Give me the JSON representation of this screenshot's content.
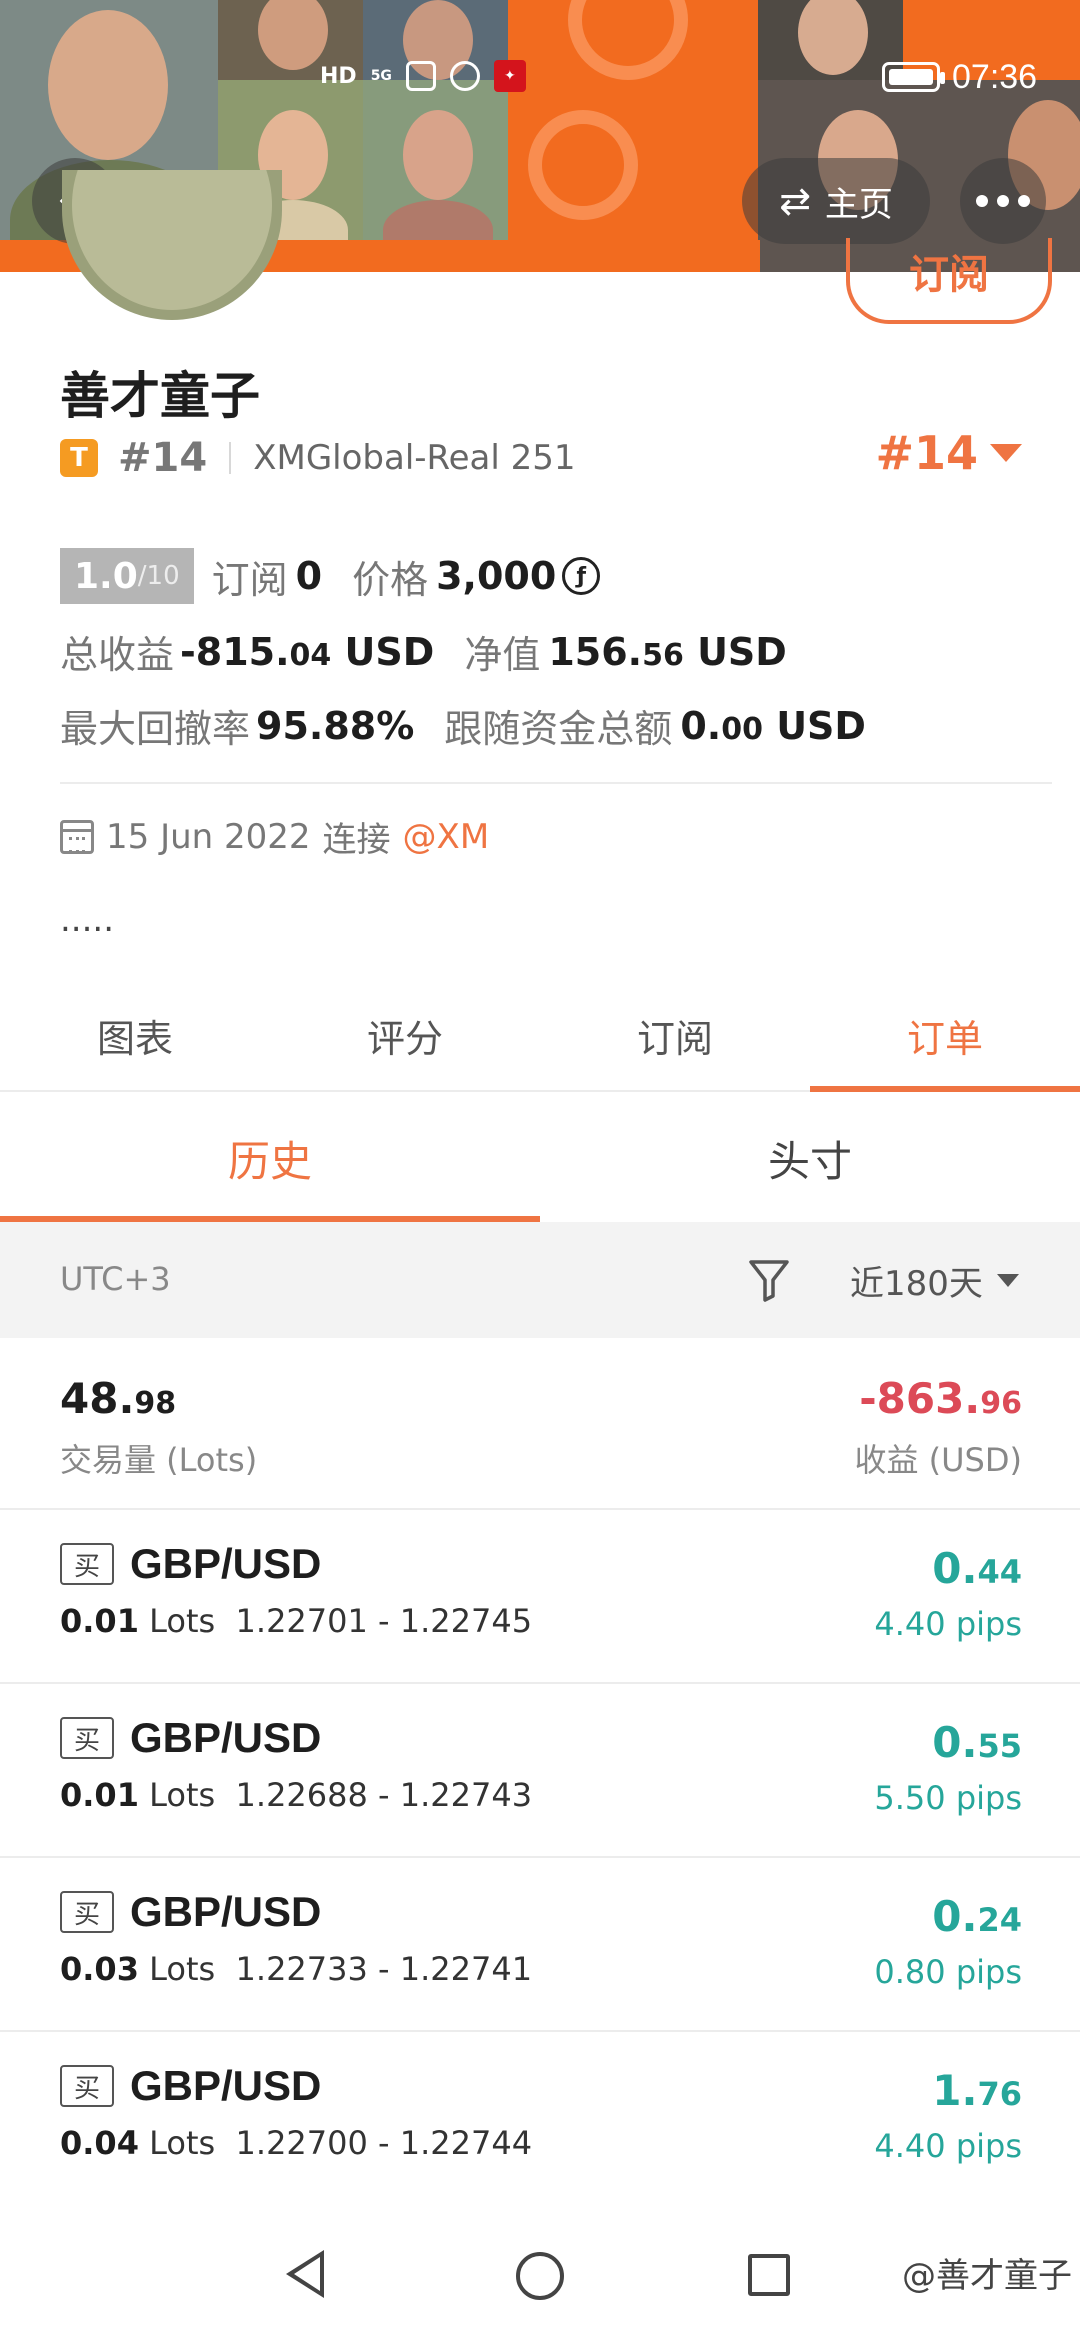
{
  "status_bar": {
    "network": "HD",
    "signal": "5G",
    "time": "07:36"
  },
  "header": {
    "home_label": "主页",
    "subscribe_label": "订阅"
  },
  "profile": {
    "name": "善才童子",
    "tier_badge": "T",
    "rank": "#14",
    "server": "XMGlobal-Real 251",
    "rank_right": "#14",
    "rating": "1.0",
    "rating_max": "/10",
    "subscriptions_label": "订阅",
    "subscriptions_value": "0",
    "price_label": "价格",
    "price_value": "3,000",
    "price_currency_icon": "ƒ",
    "total_profit_label": "总收益",
    "total_profit_main": "-815.",
    "total_profit_decimals": "04",
    "total_profit_unit": "USD",
    "equity_label": "净值",
    "equity_main": "156.",
    "equity_decimals": "56",
    "equity_unit": "USD",
    "max_drawdown_label": "最大回撤率",
    "max_drawdown_value": "95.88%",
    "follower_funds_label": "跟随资金总额",
    "follower_funds_main": "0.",
    "follower_funds_decimals": "00",
    "follower_funds_unit": "USD",
    "join_date": "15 Jun 2022",
    "join_text": "连接",
    "broker": "@XM",
    "description": "....."
  },
  "tabs": [
    "图表",
    "评分",
    "订阅",
    "订单"
  ],
  "active_tab": 3,
  "subtabs": [
    "历史",
    "头寸"
  ],
  "active_subtab": 0,
  "filter": {
    "timezone": "UTC+3",
    "period": "近180天"
  },
  "summary": {
    "volume_main": "48.",
    "volume_decimals": "98",
    "volume_label": "交易量 (Lots)",
    "profit_main": "-863.",
    "profit_decimals": "96",
    "profit_label": "收益 (USD)"
  },
  "orders": [
    {
      "side": "买",
      "symbol": "GBP/USD",
      "lots": "0.01",
      "lots_unit": "Lots",
      "prices": "1.22701 - 1.22745",
      "profit_main": "0.",
      "profit_decimals": "44",
      "pips": "4.40 pips"
    },
    {
      "side": "买",
      "symbol": "GBP/USD",
      "lots": "0.01",
      "lots_unit": "Lots",
      "prices": "1.22688 - 1.22743",
      "profit_main": "0.",
      "profit_decimals": "55",
      "pips": "5.50 pips"
    },
    {
      "side": "买",
      "symbol": "GBP/USD",
      "lots": "0.03",
      "lots_unit": "Lots",
      "prices": "1.22733 - 1.22741",
      "profit_main": "0.",
      "profit_decimals": "24",
      "pips": "0.80 pips"
    },
    {
      "side": "买",
      "symbol": "GBP/USD",
      "lots": "0.04",
      "lots_unit": "Lots",
      "prices": "1.22700 - 1.22744",
      "profit_main": "1.",
      "profit_decimals": "76",
      "pips": "4.40 pips"
    }
  ],
  "watermark": "@善才童子",
  "colors": {
    "accent": "#ef7442",
    "profit_green": "#26a69a",
    "loss_red": "#dc4a57"
  }
}
